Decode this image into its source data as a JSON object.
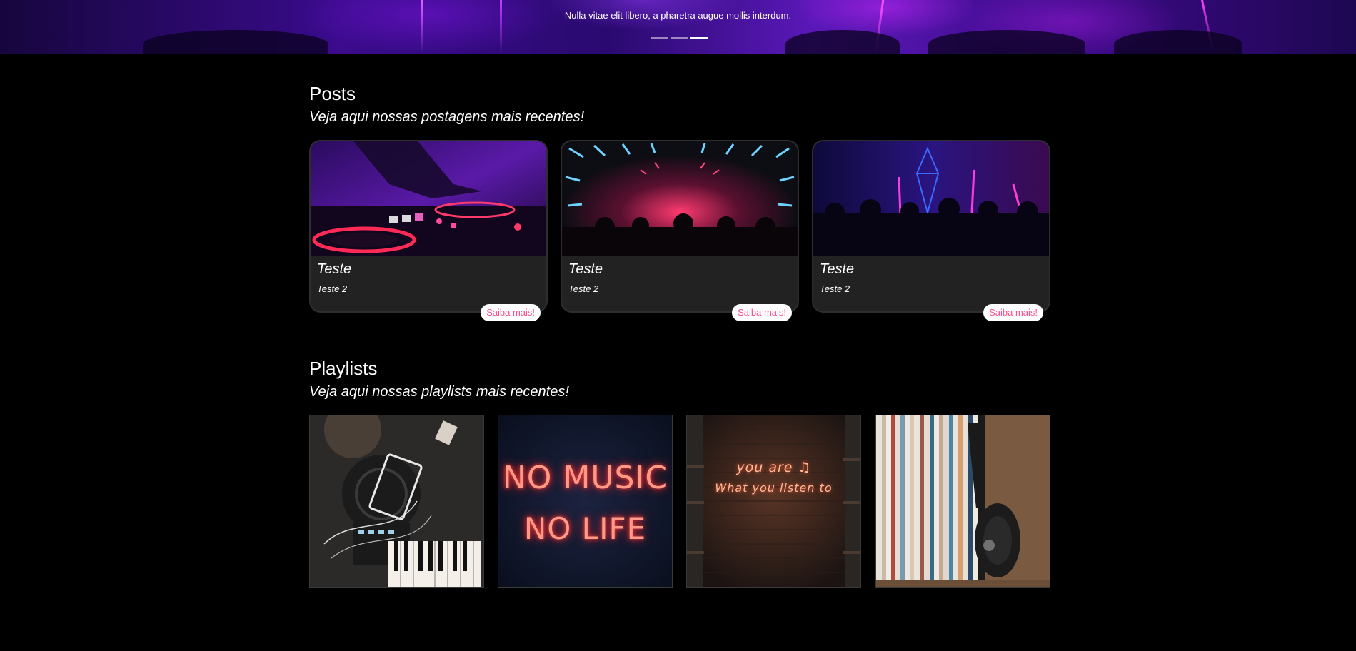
{
  "hero": {
    "caption": "Nulla vitae elit libero, a pharetra augue mollis interdum.",
    "indicators": [
      {
        "label": "slide-1",
        "active": false
      },
      {
        "label": "slide-2",
        "active": false
      },
      {
        "label": "slide-3",
        "active": true
      }
    ]
  },
  "posts": {
    "title": "Posts",
    "subtitle": "Veja aqui nossas postagens mais recentes!",
    "cards": [
      {
        "title": "Teste",
        "text": "Teste 2",
        "button": "Saiba mais!",
        "image": "dj-turntable-photo"
      },
      {
        "title": "Teste",
        "text": "Teste 2",
        "button": "Saiba mais!",
        "image": "club-tunnel-lights-photo"
      },
      {
        "title": "Teste",
        "text": "Teste 2",
        "button": "Saiba mais!",
        "image": "club-crowd-neon-photo"
      }
    ]
  },
  "playlists": {
    "title": "Playlists",
    "subtitle": "Veja aqui nossas playlists mais recentes!",
    "items": [
      {
        "image": "studio-gear-keyboard-photo"
      },
      {
        "image": "neon-sign-photo",
        "neon_line1": "NO MUSIC",
        "neon_line2": "NO LIFE"
      },
      {
        "image": "brick-wall-neon-photo",
        "neon_line1": "you are ♫",
        "neon_line2": "What you listen to"
      },
      {
        "image": "vinyl-records-headphones-photo"
      }
    ]
  },
  "colors": {
    "background": "#000000",
    "card": "#222222",
    "button_text": "#ff4f8b",
    "hero_purple": "#3a0b8c"
  }
}
